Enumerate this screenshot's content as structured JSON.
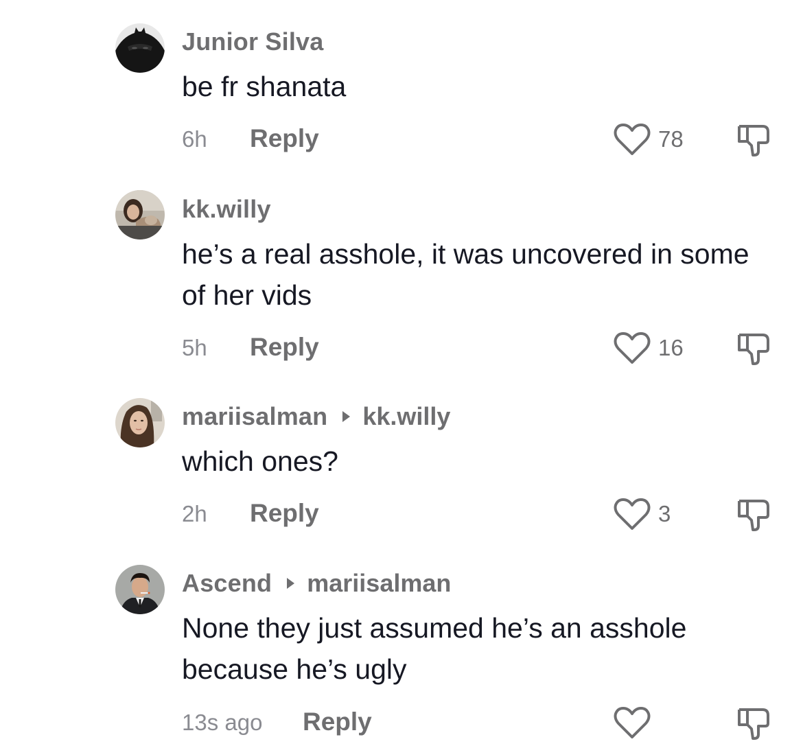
{
  "comments": [
    {
      "username": "Junior Silva",
      "reply_to": "",
      "text": "be fr shanata",
      "time": "6h",
      "reply_label": "Reply",
      "likes": "78",
      "avatar_icon": "masked-figure-avatar"
    },
    {
      "username": "kk.willy",
      "reply_to": "",
      "text": "he’s a real asshole, it was uncovered in some of her vids",
      "time": "5h",
      "reply_label": "Reply",
      "likes": "16",
      "avatar_icon": "woman-with-dog-avatar"
    },
    {
      "username": "mariisalman",
      "reply_to": "kk.willy",
      "text": "which ones?",
      "time": "2h",
      "reply_label": "Reply",
      "likes": "3",
      "avatar_icon": "woman-portrait-avatar"
    },
    {
      "username": "Ascend",
      "reply_to": "mariisalman",
      "text": "None they just assumed he’s an asshole because he’s ugly",
      "time": "13s ago",
      "reply_label": "Reply",
      "likes": "",
      "avatar_icon": "man-in-suit-avatar"
    }
  ],
  "colors": {
    "text_primary": "#161823",
    "text_secondary": "#6e6e70",
    "text_muted": "#8a8b91"
  },
  "icons": {
    "like": "heart-outline-icon",
    "dislike": "thumbs-down-outline-icon",
    "reply_indicator": "triangle-right-icon"
  }
}
